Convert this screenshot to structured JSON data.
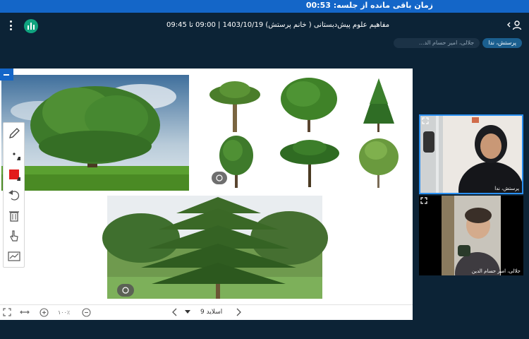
{
  "timer": {
    "label": "زمان باقی مانده از جلسه:",
    "value": "00:53"
  },
  "header": {
    "title": "مفاهیم علوم پیش‌دبستانی ( خانم پرستش) 1403/10/19 | 09:00 تا 09:45",
    "menu_icon": "more-vertical-icon",
    "logo_icon": "audio-bars-icon",
    "users_icon": "users-toggle-icon"
  },
  "participants_chips": [
    "پرستش، ندا",
    "جلالی، امیر حسام الد..."
  ],
  "slide": {
    "current_label": "اسلاید 9",
    "zoom": "۱۰۰٪"
  },
  "toolbar": {
    "tools": [
      "pencil-icon",
      "dot-size-icon",
      "color-swatch-icon",
      "undo-icon",
      "trash-icon",
      "hand-pointer-icon",
      "chart-line-icon"
    ],
    "active_color": "#e21b1b"
  },
  "videos": [
    {
      "name": "پرستش، ندا",
      "icon": "expand-icon"
    },
    {
      "name": "جلالی، امیر حسام الدین",
      "icon": "expand-icon"
    }
  ],
  "colors": {
    "background": "#0c2336",
    "accent": "#1466c8",
    "logo": "#10a37f",
    "active_border": "#2a8ff0"
  }
}
